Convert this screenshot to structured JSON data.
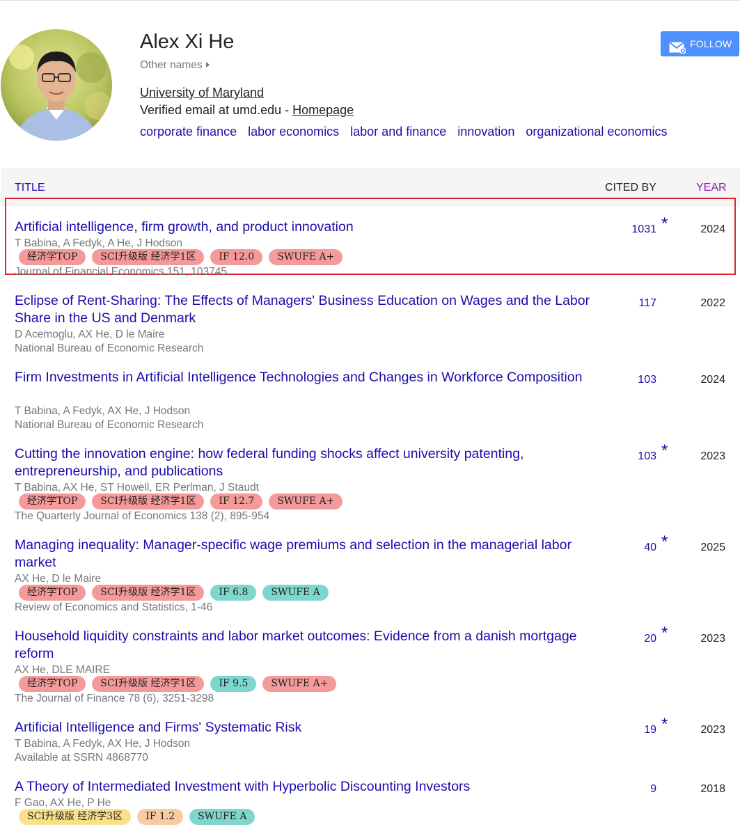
{
  "profile": {
    "name": "Alex Xi He",
    "other_names": "Other names",
    "affiliation": "University of Maryland",
    "email_prefix": "Verified email at umd.edu - ",
    "homepage": "Homepage",
    "interests": [
      "corporate finance",
      "labor economics",
      "labor and finance",
      "innovation",
      "organizational economics"
    ],
    "follow_label": "FOLLOW"
  },
  "table": {
    "title_header": "TITLE",
    "cited_header": "CITED BY",
    "year_header": "YEAR"
  },
  "articles": [
    {
      "title": "Artificial intelligence, firm growth, and product innovation",
      "authors": "T Babina, A Fedyk, A He, J Hodson",
      "tags": [
        "经济学TOP",
        "SCI升级版 经济学1区",
        "IF 12.0",
        "SWUFE A+"
      ],
      "venue": "Journal of Financial Economics 151, 103745",
      "cited": "1031",
      "star": "*",
      "year": "2024"
    },
    {
      "title": "Eclipse of Rent-Sharing: The Effects of Managers' Business Education on Wages and the Labor Share in the US and Denmark",
      "authors": "D Acemoglu, AX He, D le Maire",
      "tags": [],
      "venue": "National Bureau of Economic Research",
      "cited": "117",
      "star": "",
      "year": "2022"
    },
    {
      "title": "Firm Investments in Artificial Intelligence Technologies and Changes in Workforce Composition",
      "authors": "T Babina, A Fedyk, AX He, J Hodson",
      "tags": [],
      "venue": "National Bureau of Economic Research",
      "cited": "103",
      "star": "",
      "year": "2024"
    },
    {
      "title": "Cutting the innovation engine: how federal funding shocks affect university patenting, entrepreneurship, and publications",
      "authors": "T Babina, AX He, ST Howell, ER Perlman, J Staudt",
      "tags": [
        "经济学TOP",
        "SCI升级版 经济学1区",
        "IF 12.7",
        "SWUFE A+"
      ],
      "venue": "The Quarterly Journal of Economics 138 (2), 895-954",
      "cited": "103",
      "star": "*",
      "year": "2023"
    },
    {
      "title": "Managing inequality: Manager-specific wage premiums and selection in the managerial labor market",
      "authors": "AX He, D le Maire",
      "tags": [
        "经济学TOP",
        "SCI升级版 经济学1区",
        "IF 6.8",
        "SWUFE A"
      ],
      "venue": "Review of Economics and Statistics, 1-46",
      "cited": "40",
      "star": "*",
      "year": "2025"
    },
    {
      "title": "Household liquidity constraints and labor market outcomes: Evidence from a danish mortgage reform",
      "authors": "AX He, DLE MAIRE",
      "tags": [
        "经济学TOP",
        "SCI升级版 经济学1区",
        "IF 9.5",
        "SWUFE A+"
      ],
      "venue": "The Journal of Finance 78 (6), 3251-3298",
      "cited": "20",
      "star": "*",
      "year": "2023"
    },
    {
      "title": "Artificial Intelligence and Firms' Systematic Risk",
      "authors": "T Babina, A Fedyk, AX He, J Hodson",
      "tags": [],
      "venue": "Available at SSRN 4868770",
      "cited": "19",
      "star": "*",
      "year": "2023"
    },
    {
      "title": "A Theory of Intermediated Investment with Hyperbolic Discounting Investors",
      "authors": "F Gao, AX He, P He",
      "tags": [
        "SCI升级版 经济学3区",
        "IF 1.2",
        "SWUFE A"
      ],
      "venue": "",
      "cited": "9",
      "star": "",
      "year": "2018"
    }
  ]
}
